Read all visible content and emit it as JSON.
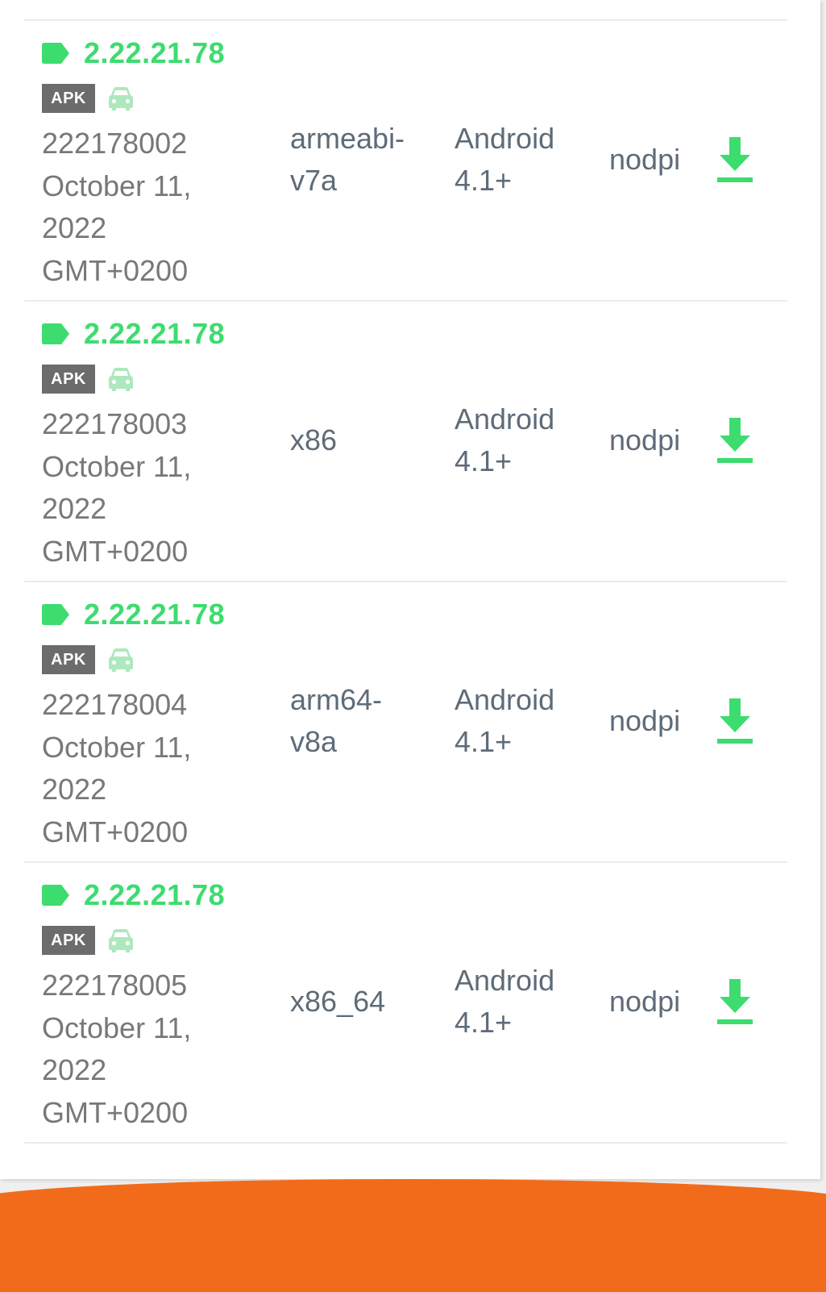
{
  "colors": {
    "accent_green": "#3ddc6f",
    "badge_gray": "#6c6c6c",
    "text_gray": "#787878",
    "text_slate": "#5e6b78",
    "footer_orange": "#f26b1a"
  },
  "icons": {
    "tag": "tag-icon",
    "car": "car-icon",
    "download": "download-icon"
  },
  "variants": [
    {
      "version": "2.22.21.78",
      "badge": "APK",
      "build": "222178002",
      "date_line1": "October 11,",
      "date_line2": "2022",
      "timezone": "GMT+0200",
      "arch_line1": "armeabi-",
      "arch_line2": "v7a",
      "android_line1": "Android",
      "android_line2": "4.1+",
      "dpi": "nodpi"
    },
    {
      "version": "2.22.21.78",
      "badge": "APK",
      "build": "222178003",
      "date_line1": "October 11,",
      "date_line2": "2022",
      "timezone": "GMT+0200",
      "arch_line1": "x86",
      "arch_line2": "",
      "android_line1": "Android",
      "android_line2": "4.1+",
      "dpi": "nodpi"
    },
    {
      "version": "2.22.21.78",
      "badge": "APK",
      "build": "222178004",
      "date_line1": "October 11,",
      "date_line2": "2022",
      "timezone": "GMT+0200",
      "arch_line1": "arm64-",
      "arch_line2": "v8a",
      "android_line1": "Android",
      "android_line2": "4.1+",
      "dpi": "nodpi"
    },
    {
      "version": "2.22.21.78",
      "badge": "APK",
      "build": "222178005",
      "date_line1": "October 11,",
      "date_line2": "2022",
      "timezone": "GMT+0200",
      "arch_line1": "x86_64",
      "arch_line2": "",
      "android_line1": "Android",
      "android_line2": "4.1+",
      "dpi": "nodpi"
    }
  ]
}
